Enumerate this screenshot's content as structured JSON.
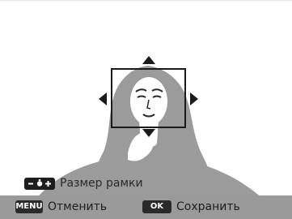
{
  "preview": {
    "tones": {
      "shadow": "#9b9b9b",
      "background": "#ffffff",
      "ink": "#1a1a1a"
    }
  },
  "hint": {
    "icon": "zoom-minus-plus-icon",
    "label": "Размер рамки"
  },
  "bottom_bar": {
    "background": "#9a9a9a",
    "cancel": {
      "key": "MENU",
      "label": "Отменить"
    },
    "save": {
      "key": "OK",
      "label": "Сохранить"
    }
  }
}
